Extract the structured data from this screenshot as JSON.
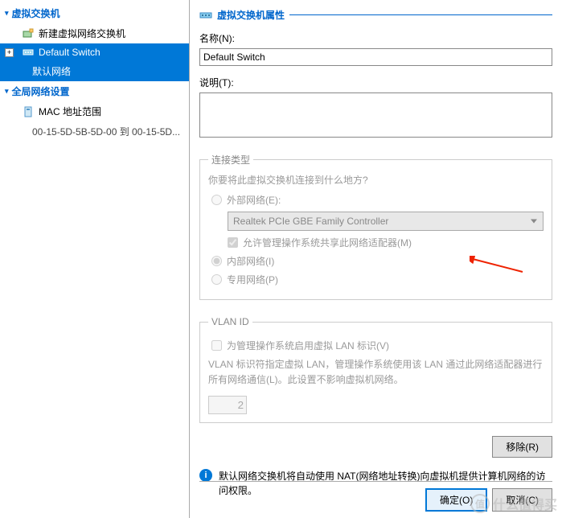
{
  "left": {
    "section1": "虚拟交换机",
    "new_switch": "新建虚拟网络交换机",
    "default_switch": "Default Switch",
    "default_net": "默认网络",
    "section2": "全局网络设置",
    "mac_range": "MAC 地址范围",
    "mac_value": "00-15-5D-5B-5D-00 到 00-15-5D..."
  },
  "right": {
    "header": "虚拟交换机属性",
    "name_label": "名称(N):",
    "name_value": "Default Switch",
    "desc_label": "说明(T):",
    "conn": {
      "legend": "连接类型",
      "question": "你要将此虚拟交换机连接到什么地方?",
      "external": "外部网络(E):",
      "adapter": "Realtek PCIe GBE Family Controller",
      "allow_mgmt": "允许管理操作系统共享此网络适配器(M)",
      "internal": "内部网络(I)",
      "private": "专用网络(P)"
    },
    "vlan": {
      "legend": "VLAN ID",
      "enable": "为管理操作系统启用虚拟 LAN 标识(V)",
      "text": "VLAN 标识符指定虚拟 LAN，管理操作系统使用该 LAN 通过此网络适配器进行所有网络通信(L)。此设置不影响虚拟机网络。",
      "value": "2"
    },
    "remove": "移除(R)",
    "info": "默认网络交换机将自动使用 NAT(网络地址转换)向虚拟机提供计算机网络的访问权限。",
    "ok": "确定(O)",
    "cancel": "取消(C)"
  },
  "watermark": "什么值得买"
}
